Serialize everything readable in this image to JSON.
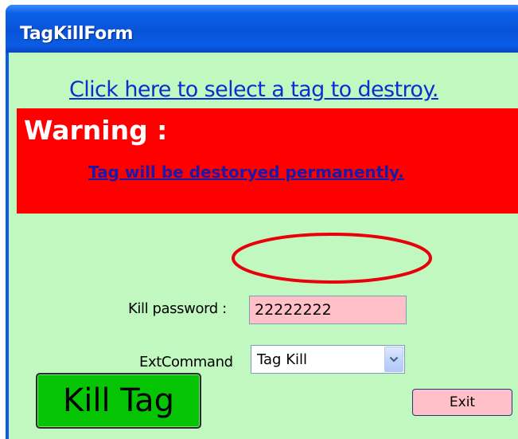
{
  "window": {
    "title": "TagKillForm"
  },
  "main": {
    "select_link": "Click here to select a tag to destroy.",
    "warning": {
      "title": "Warning :",
      "message": "Tag will be destoryed permanently."
    },
    "password": {
      "label": "Kill password :",
      "value": "22222222"
    },
    "ext_command": {
      "label": "ExtCommand",
      "selected": "Tag Kill"
    },
    "kill_button": "Kill Tag",
    "exit_button": "Exit"
  },
  "colors": {
    "form_background": "#c1f8c0",
    "warning_background": "#ff0000",
    "kill_button": "#04c404",
    "input_background": "#ffc0c8",
    "highlight_ellipse": "#e8000b",
    "titlebar": "#0a5ce6"
  },
  "icons": {
    "dropdown": "chevron-down-icon"
  }
}
